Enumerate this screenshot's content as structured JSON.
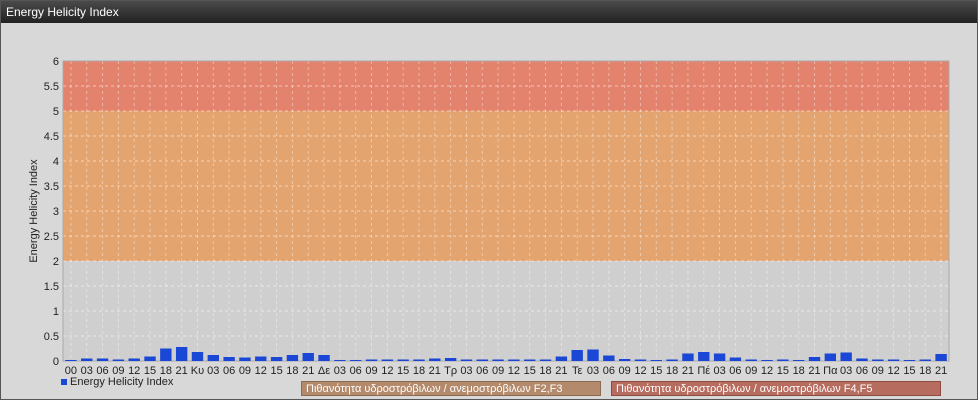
{
  "window": {
    "title": "Energy Helicity Index"
  },
  "colors": {
    "bar": "#1a47d6",
    "band_low": "#c9c9c9",
    "band_mid": "#e3a46f",
    "band_high": "#e3826d",
    "plot_bg": "#cfcfcf"
  },
  "bands": [
    {
      "label": "Πιθανότητα υδροστρόβιλων / ανεμοστρόβιλων F2,F3",
      "from": 2,
      "to": 5
    },
    {
      "label": "Πιθανότητα υδροστρόβιλων / ανεμοστρόβιλων F4,F5",
      "from": 5,
      "to": 6
    }
  ],
  "chart_data": {
    "type": "bar",
    "title": "",
    "xlabel": "",
    "ylabel": "Energy Helicity Index",
    "ylim": [
      0,
      6
    ],
    "yticks": [
      "0",
      "0.5",
      "1",
      "1.5",
      "2",
      "2.5",
      "3",
      "3.5",
      "4",
      "4.5",
      "5",
      "5.5",
      "6"
    ],
    "grid": true,
    "legend_placement": "bottom-left",
    "categories": [
      "00",
      "03",
      "06",
      "09",
      "12",
      "15",
      "18",
      "21",
      "Κυ",
      "03",
      "06",
      "09",
      "12",
      "15",
      "18",
      "21",
      "Δε",
      "03",
      "06",
      "09",
      "12",
      "15",
      "18",
      "21",
      "Τρ",
      "03",
      "06",
      "09",
      "12",
      "15",
      "18",
      "21",
      "Τε",
      "03",
      "06",
      "09",
      "12",
      "15",
      "18",
      "21",
      "Πέ",
      "03",
      "06",
      "09",
      "12",
      "15",
      "18",
      "21",
      "Πα",
      "03",
      "06",
      "09",
      "12",
      "15",
      "18",
      "21"
    ],
    "series": [
      {
        "name": "Energy Helicity Index",
        "values": [
          0.02,
          0.05,
          0.05,
          0.03,
          0.05,
          0.09,
          0.25,
          0.28,
          0.18,
          0.12,
          0.08,
          0.07,
          0.09,
          0.08,
          0.12,
          0.16,
          0.12,
          0.02,
          0.02,
          0.03,
          0.03,
          0.03,
          0.03,
          0.05,
          0.06,
          0.03,
          0.03,
          0.03,
          0.03,
          0.03,
          0.03,
          0.09,
          0.22,
          0.23,
          0.11,
          0.04,
          0.03,
          0.02,
          0.03,
          0.15,
          0.18,
          0.15,
          0.07,
          0.03,
          0.02,
          0.03,
          0.02,
          0.08,
          0.15,
          0.17,
          0.05,
          0.03,
          0.03,
          0.02,
          0.03,
          0.14,
          0.14
        ]
      }
    ]
  }
}
